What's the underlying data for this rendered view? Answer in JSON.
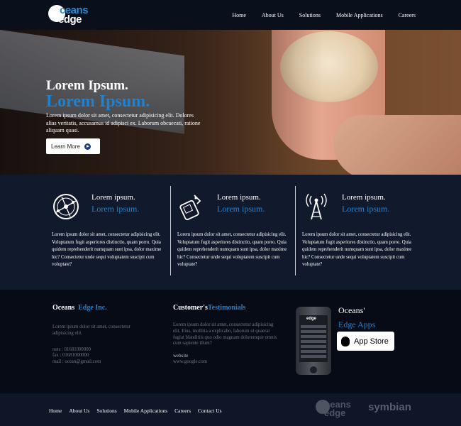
{
  "brand": {
    "logo_top": "ceans",
    "logo_bottom": "edge"
  },
  "nav": [
    "Home",
    "About Us",
    "Solutions",
    "Mobile Applications",
    "Careers"
  ],
  "hero": {
    "title_1": "Lorem Ipsum.",
    "title_2": "Lorem Ipsum.",
    "description": "Lorem ipsum dolor sit amet, consectetur adipisicing elit. Dolores alias veritatis, accusamus id adipisci ex. Laborum obcaecati, ratione aliquam quasi.",
    "button": "Learn More"
  },
  "features": [
    {
      "icon": "globe-network-icon",
      "heading": "Lorem ipsum.",
      "subheading": "Lorem ipsum.",
      "text": "Lorem ipsum dolor sit amet, consectetur adipisicing elit. Voluptatum fugit asperiores distinctio, quam porro. Quia quidem reprehenderit numquam sunt ipsa, dolor maxime hic? Consectetur unde sequi voluptatem suscipit cum voluptate?"
    },
    {
      "icon": "mobile-touch-icon",
      "heading": "Lorem ipsum.",
      "subheading": "Lorem ipsum.",
      "text": "Lorem ipsum dolor sit amet, consectetur adipisicing elit. Voluptatum fugit asperiores distinctio, quam porro. Quia quidem reprehenderit numquam sunt ipsa, dolor maxime hic? Consectetur unde sequi voluptatem suscipit cum voluptate?"
    },
    {
      "icon": "antenna-tower-icon",
      "heading": "Lorem ipsum.",
      "subheading": "Lorem ipsum.",
      "text": "Lorem ipsum dolor sit amet, consectetur adipisicing elit. Voluptatum fugit asperiores distinctio, quam porro. Quia quidem reprehenderit numquam sunt ipsa, dolor maxime hic? Consectetur unde sequi voluptatem suscipit cum voluptate?"
    }
  ],
  "company": {
    "title_white": "Oceans",
    "title_blue": "Edge Inc.",
    "text": "Lorem ipsum dolor sit amet, consectetur adipisicing elit.",
    "nuts": "nuts : 01681000000",
    "fax": "fax : 01681000000",
    "mail": "mail : ocean@gmail.com"
  },
  "testimonials": {
    "title_white": "Customer's",
    "title_blue": "Testimonials",
    "text": "Lorem ipsum dolor sit amet, consectetur adipisicing elit. Eius, mollitia a explicabo, laborum ut quaerat fugiat blanditiis quo odio magnam doloremque omnis cum sapiente illum?",
    "website_label": "website",
    "website_url": "www.google.com"
  },
  "apps": {
    "title_white": "Oceans'",
    "title_blue": "Edge Apps",
    "button": "App Store",
    "phone_logo": "edge"
  },
  "footer": {
    "links": [
      "Home",
      "About Us",
      "Solutions",
      "Mobile Applications",
      "Careers",
      "Contact Us"
    ],
    "logo_top": "ceans",
    "logo_bottom": "edge",
    "partner": "symbian"
  }
}
